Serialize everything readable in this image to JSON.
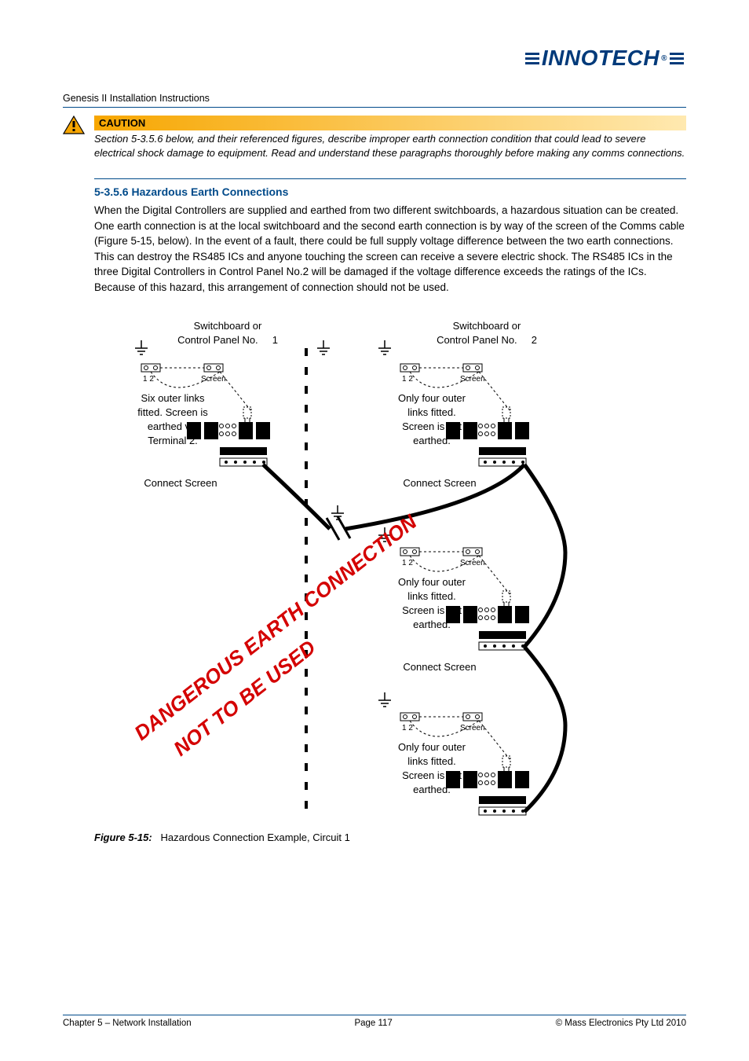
{
  "brand": "INNOTECH",
  "doc_title": "Genesis II Installation Instructions",
  "caution": {
    "label": "CAUTION",
    "text": "Section 5-3.5.6 below, and their referenced figures, describe improper earth connection condition that could lead to severe electrical shock damage to equipment.  Read and understand these paragraphs thoroughly before making any comms connections."
  },
  "section": {
    "heading": "5-3.5.6 Hazardous Earth Connections",
    "body": "When the Digital Controllers are supplied and earthed from two different switchboards, a hazardous situation can be created.  One earth connection is at the local switchboard and the second earth connection is by way of the screen of the Comms cable (Figure 5-15, below).  In the event of a fault, there could be full supply voltage difference between the two earth connections.  This can destroy the RS485 ICs and anyone touching the screen can receive a severe electric shock.  The RS485 ICs in the three Digital Controllers in Control Panel No.2  will be damaged if the voltage difference exceeds the ratings of the ICs.  Because of this hazard, this arrangement of connection should not be used."
  },
  "diagram": {
    "panel1_l1": "Switchboard or",
    "panel1_l2": "Control Panel No.",
    "panel1_n": "1",
    "panel2_l1": "Switchboard or",
    "panel2_l2": "Control Panel No.",
    "panel2_n": "2",
    "term_12": "1 2",
    "term_screen": "Screen",
    "note_six_l1": "Six outer links",
    "note_six_l2": "fitted. Screen is",
    "note_six_l3": "earthed via",
    "note_six_l4": "Terminal 2.",
    "note_four_l1": "Only four outer",
    "note_four_l2": "links fitted.",
    "note_four_l3": "Screen is not",
    "note_four_l4": "earthed.",
    "connect_screen": "Connect Screen",
    "warn1": "DANGEROUS EARTH CONNECTION",
    "warn2": "NOT TO BE USED"
  },
  "figure_caption_label": "Figure 5-15:",
  "figure_caption_text": "Hazardous Connection Example, Circuit 1",
  "footer": {
    "left": "Chapter 5 – Network Installation",
    "center": "Page 117",
    "right": "© Mass Electronics Pty Ltd  2010"
  }
}
